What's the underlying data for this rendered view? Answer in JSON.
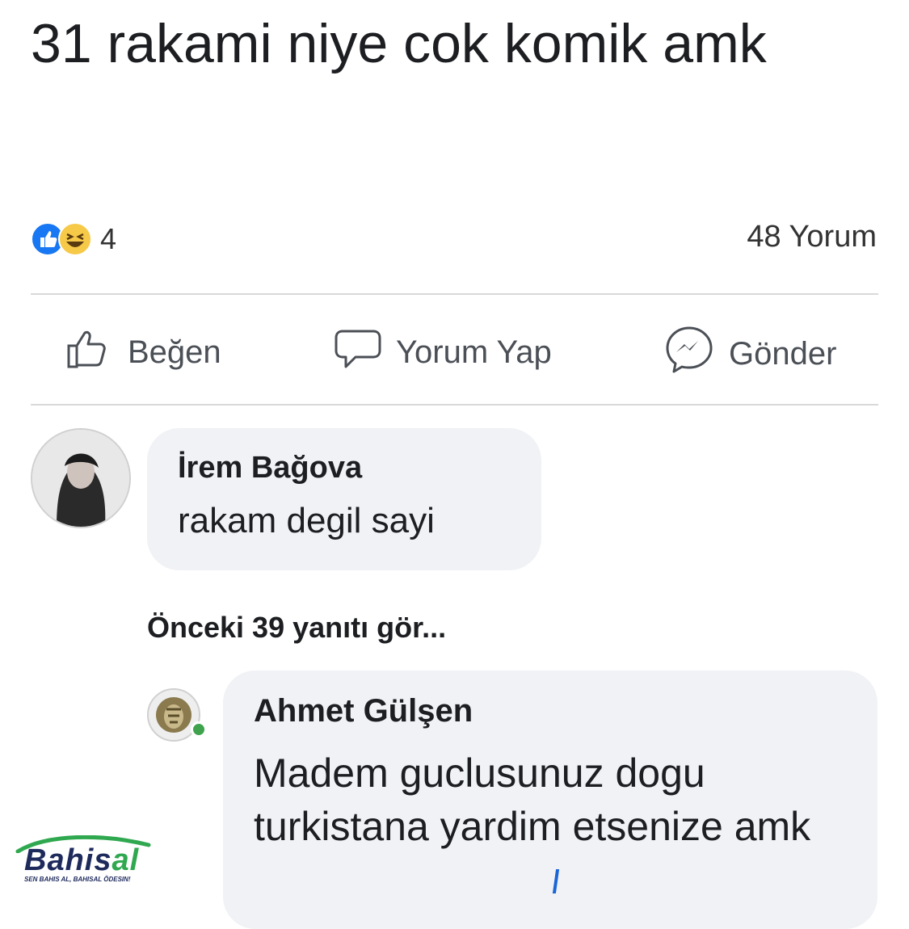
{
  "post": {
    "text": "31 rakami niye cok komik amk",
    "reaction_count": "4",
    "comment_count": "48 Yorum",
    "reactions": [
      "like-icon",
      "haha-icon"
    ]
  },
  "actions": {
    "like_label": "Beğen",
    "comment_label": "Yorum Yap",
    "send_label": "Gönder"
  },
  "comments": [
    {
      "author": "İrem Bağova",
      "text": "rakam degil sayi"
    }
  ],
  "previous_replies_label": "Önceki 39 yanıtı gör...",
  "replies": [
    {
      "author": "Ahmet Gülşen",
      "text": "Madem guclusunuz dogu turkistana yardim etsenize amk"
    }
  ],
  "watermark": {
    "brand_prefix": "Bahis",
    "brand_suffix": "al",
    "tagline": "SEN BAHIS AL, BAHISAL ÖDESIN!"
  },
  "colors": {
    "like_blue": "#1877f2",
    "bubble_gray": "#f0f2f5",
    "brand_navy": "#1e2a5c",
    "brand_green": "#2fa84f"
  }
}
